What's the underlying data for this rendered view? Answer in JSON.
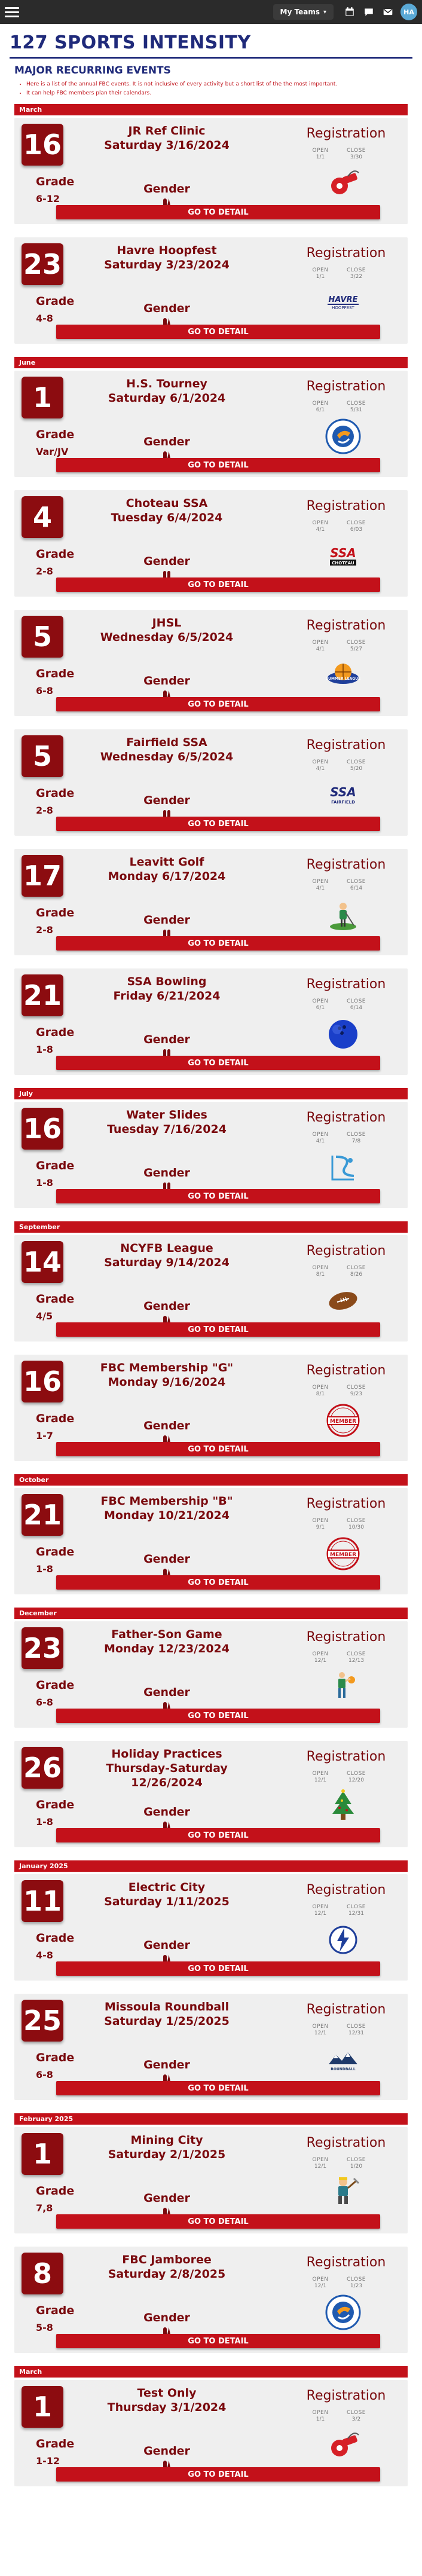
{
  "nav": {
    "teams_label": "My Teams",
    "avatar_initials": "HA"
  },
  "page_title": "127 SPORTS INTENSITY",
  "section_title": "MAJOR RECURRING EVENTS",
  "notes": [
    "Here is a list of the annual FBC events.  It is not inclusive of every activity but a short list of the the most important.",
    "It can help FBC members plan their calendars."
  ],
  "registration_label": "Registration",
  "open_label": "OPEN",
  "close_label": "CLOSE",
  "grade_label": "Grade",
  "gender_label": "Gender",
  "detail_label": "GO TO DETAIL",
  "events": [
    {
      "month": "March",
      "day": "16",
      "name": "JR Ref Clinic",
      "date": "Saturday 3/16/2024",
      "grade": "6-12",
      "gender": "mixed",
      "open": "1/1",
      "close": "3/30",
      "logo": "whistle-logo"
    },
    {
      "month": "",
      "day": "23",
      "name": "Havre Hoopfest",
      "date": "Saturday 3/23/2024",
      "grade": "4-8",
      "gender": "mixed",
      "open": "1/1",
      "close": "3/22",
      "logo": "havre-hoopfest-logo"
    },
    {
      "month": "June",
      "day": "1",
      "name": "H.S. Tourney",
      "date": "Saturday 6/1/2024",
      "grade": "Var/JV",
      "gender": "mixed",
      "open": "6/1",
      "close": "5/31",
      "logo": "sports-club-logo"
    },
    {
      "month": "",
      "day": "4",
      "name": "Choteau SSA",
      "date": "Tuesday 6/4/2024",
      "grade": "2-8",
      "gender": "pair",
      "open": "4/1",
      "close": "6/03",
      "logo": "ssa-choteau-logo"
    },
    {
      "month": "",
      "day": "5",
      "name": "JHSL",
      "date": "Wednesday 6/5/2024",
      "grade": "6-8",
      "gender": "mixed",
      "open": "4/1",
      "close": "5/27",
      "logo": "jhsl-logo"
    },
    {
      "month": "",
      "day": "5",
      "name": "Fairfield SSA",
      "date": "Wednesday 6/5/2024",
      "grade": "2-8",
      "gender": "pair",
      "open": "4/1",
      "close": "5/20",
      "logo": "ssa-fairfield-logo"
    },
    {
      "month": "",
      "day": "17",
      "name": "Leavitt Golf",
      "date": "Monday 6/17/2024",
      "grade": "2-8",
      "gender": "pair",
      "open": "4/1",
      "close": "6/14",
      "logo": "golf-logo"
    },
    {
      "month": "",
      "day": "21",
      "name": "SSA Bowling",
      "date": "Friday 6/21/2024",
      "grade": "1-8",
      "gender": "pair",
      "open": "6/1",
      "close": "6/14",
      "logo": "bowling-logo"
    },
    {
      "month": "July",
      "day": "16",
      "name": "Water Slides",
      "date": "Tuesday 7/16/2024",
      "grade": "1-8",
      "gender": "pair",
      "open": "4/1",
      "close": "7/8",
      "logo": "water-slide-logo"
    },
    {
      "month": "September",
      "day": "14",
      "name": "NCYFB League",
      "date": "Saturday 9/14/2024",
      "grade": "4/5",
      "gender": "mixed",
      "open": "8/1",
      "close": "8/26",
      "logo": "football-logo"
    },
    {
      "month": "",
      "day": "16",
      "name": "FBC Membership \"G\"",
      "date": "Monday 9/16/2024",
      "grade": "1-7",
      "gender": "mixed",
      "open": "8/1",
      "close": "9/23",
      "logo": "member-stamp-logo"
    },
    {
      "month": "October",
      "day": "21",
      "name": "FBC Membership \"B\"",
      "date": "Monday 10/21/2024",
      "grade": "1-8",
      "gender": "mixed",
      "open": "9/1",
      "close": "10/30",
      "logo": "member-stamp-logo"
    },
    {
      "month": "December",
      "day": "23",
      "name": "Father-Son Game",
      "date": "Monday 12/23/2024",
      "grade": "6-8",
      "gender": "mixed",
      "open": "12/1",
      "close": "12/13",
      "logo": "basketball-player-logo"
    },
    {
      "month": "",
      "day": "26",
      "name": "Holiday Practices",
      "date": "Thursday-Saturday 12/26/2024",
      "grade": "1-8",
      "gender": "mixed",
      "open": "12/1",
      "close": "12/20",
      "logo": "christmas-tree-logo"
    },
    {
      "month": "January 2025",
      "day": "11",
      "name": "Electric City",
      "date": "Saturday 1/11/2025",
      "grade": "4-8",
      "gender": "mixed",
      "open": "12/1",
      "close": "12/31",
      "logo": "electric-city-logo"
    },
    {
      "month": "",
      "day": "25",
      "name": "Missoula Roundball",
      "date": "Saturday 1/25/2025",
      "grade": "6-8",
      "gender": "mixed",
      "open": "12/1",
      "close": "12/31",
      "logo": "roundball-logo"
    },
    {
      "month": "February 2025",
      "day": "1",
      "name": "Mining City",
      "date": "Saturday 2/1/2025",
      "grade": "7,8",
      "gender": "mixed",
      "open": "12/1",
      "close": "1/20",
      "logo": "miner-logo"
    },
    {
      "month": "",
      "day": "8",
      "name": "FBC Jamboree",
      "date": "Saturday 2/8/2025",
      "grade": "5-8",
      "gender": "mixed",
      "open": "12/1",
      "close": "1/23",
      "logo": "sports-club-logo"
    },
    {
      "month": "March",
      "day": "1",
      "name": "Test Only",
      "date": "Thursday 3/1/2024",
      "grade": "1-12",
      "gender": "mixed",
      "open": "1/1",
      "close": "3/2",
      "logo": "whistle-logo"
    }
  ]
}
